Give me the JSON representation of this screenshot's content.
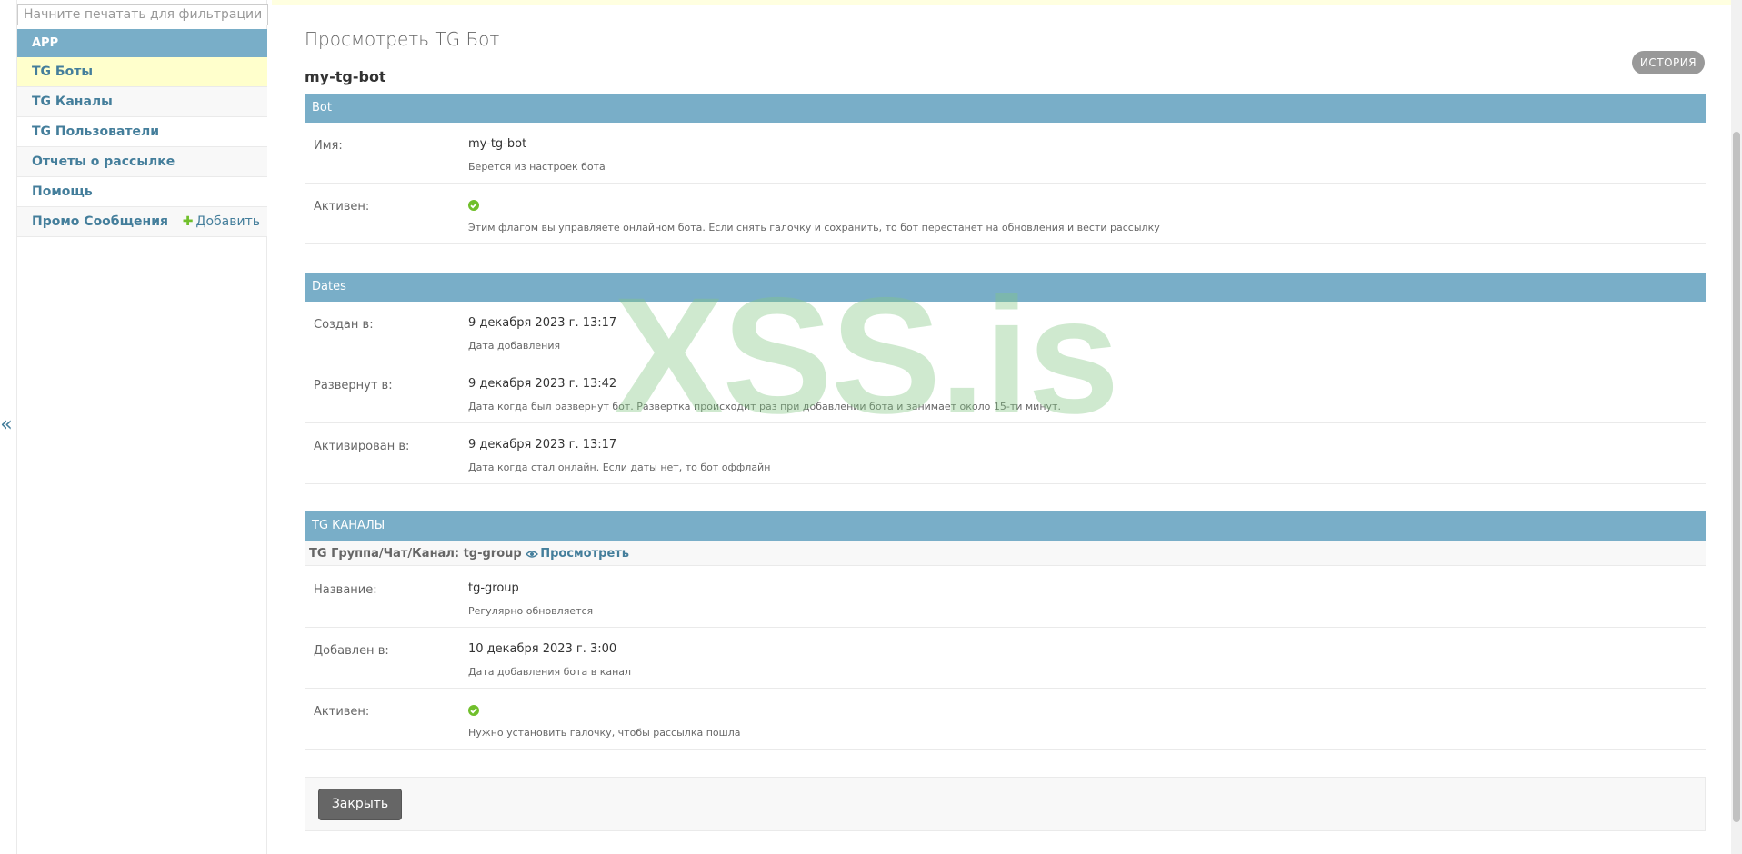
{
  "sidebar": {
    "filter_placeholder": "Начните печатать для фильтрации...",
    "app_label": "APP",
    "items": [
      {
        "label": "TG Боты"
      },
      {
        "label": "TG Каналы"
      },
      {
        "label": "TG Пользователи"
      },
      {
        "label": "Отчеты о рассылке"
      },
      {
        "label": "Помощь"
      },
      {
        "label": "Промо Сообщения",
        "add_label": "Добавить"
      }
    ],
    "collapse_glyph": "«"
  },
  "page": {
    "title": "Просмотреть TG Бот",
    "object_name": "my-tg-bot",
    "history_label": "ИСТОРИЯ"
  },
  "fieldsets": {
    "bot": {
      "title": "Bot",
      "name_label": "Имя:",
      "name_value": "my-tg-bot",
      "name_help": "Берется из настроек бота",
      "active_label": "Активен:",
      "active_icon": "check-circle-icon",
      "active_help": "Этим флагом вы управляете онлайном бота. Если снять галочку и сохранить, то бот перестанет на обновления и вести рассылку"
    },
    "dates": {
      "title": "Dates",
      "created_label": "Создан в:",
      "created_value": "9 декабря 2023 г. 13:17",
      "created_help": "Дата добавления",
      "deployed_label": "Развернут в:",
      "deployed_value": "9 декабря 2023 г. 13:42",
      "deployed_help": "Дата когда был развернут бот. Развертка происходит раз при добавлении бота и занимает около 15-ти минут.",
      "activated_label": "Активирован в:",
      "activated_value": "9 декабря 2023 г. 13:17",
      "activated_help": "Дата когда стал онлайн. Если даты нет, то бот оффлайн"
    },
    "channels": {
      "title": "TG КАНАЛЫ",
      "inline_heading": "TG Группа/Чат/Канал: tg-group",
      "view_link": "Просмотреть",
      "title_label": "Название:",
      "title_value": "tg-group",
      "title_help": "Регулярно обновляется",
      "added_label": "Добавлен в:",
      "added_value": "10 декабря 2023 г. 3:00",
      "added_help": "Дата добавления бота в канал",
      "active_label": "Активен:",
      "active_icon": "check-circle-icon",
      "active_help": "Нужно установить галочку, чтобы рассылка пошла"
    }
  },
  "actions": {
    "close_label": "Закрыть"
  },
  "watermark": "XSS.is",
  "colors": {
    "header_blue": "#79aec8",
    "link_blue": "#447e9b",
    "selected_yellow": "#ffffcc",
    "success_green": "#70bf2b"
  }
}
